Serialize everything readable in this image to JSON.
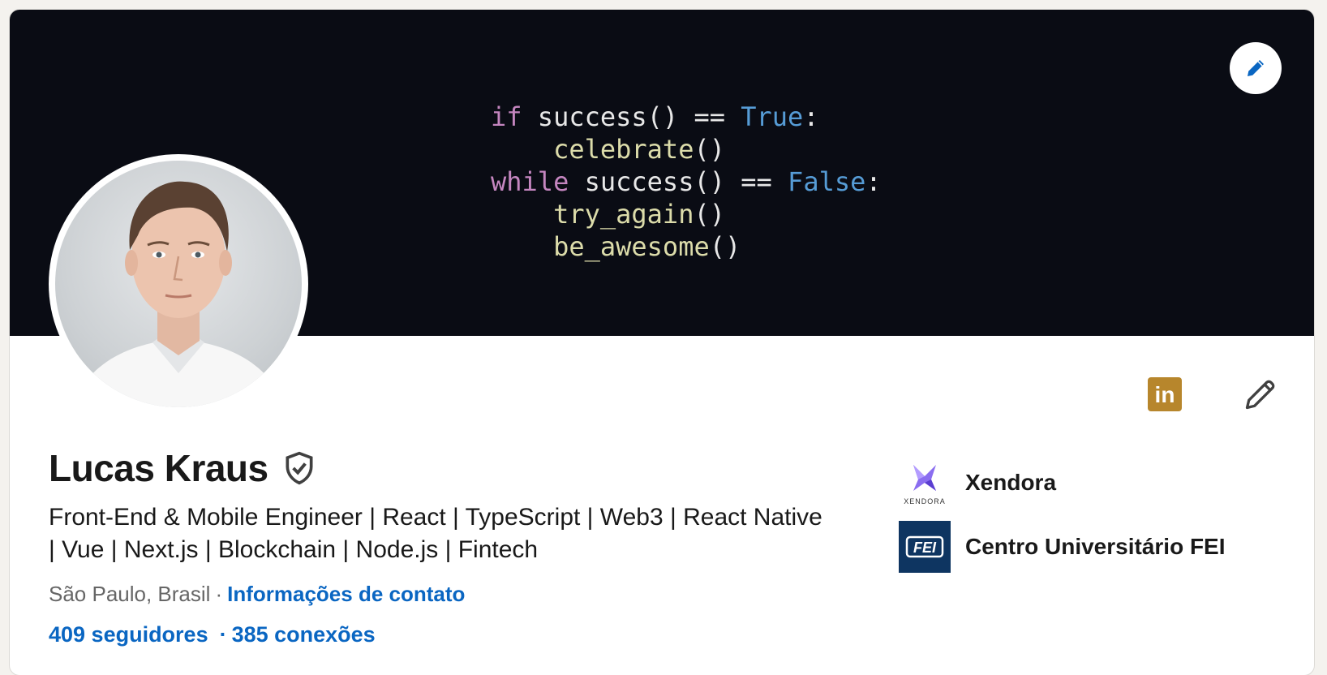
{
  "banner": {
    "code_lines": [
      [
        {
          "t": "if",
          "c": "kw"
        },
        {
          "t": " success() == ",
          "c": "plain"
        },
        {
          "t": "True",
          "c": "bool"
        },
        {
          "t": ":",
          "c": "plain"
        }
      ],
      [
        {
          "t": "    ",
          "c": "plain"
        },
        {
          "t": "celebrate",
          "c": "fn"
        },
        {
          "t": "()",
          "c": "plain"
        }
      ],
      [
        {
          "t": "while",
          "c": "kw"
        },
        {
          "t": " success() == ",
          "c": "plain"
        },
        {
          "t": "False",
          "c": "bool"
        },
        {
          "t": ":",
          "c": "plain"
        }
      ],
      [
        {
          "t": "    ",
          "c": "plain"
        },
        {
          "t": "try_again",
          "c": "fn"
        },
        {
          "t": "()",
          "c": "plain"
        }
      ],
      [
        {
          "t": "    ",
          "c": "plain"
        },
        {
          "t": "be_awesome",
          "c": "fn"
        },
        {
          "t": "()",
          "c": "plain"
        }
      ]
    ],
    "edit_icon": "pencil-icon",
    "background_color": "#0a0c14"
  },
  "profile": {
    "name": "Lucas Kraus",
    "verified_icon": "shield-check-icon",
    "headline": "Front-End & Mobile Engineer | React | TypeScript | Web3 | React Native | Vue | Next.js | Blockchain | Node.js | Fintech",
    "location": "São Paulo, Brasil",
    "location_separator": "·",
    "contact_link": "Informações de contato",
    "followers": "409 seguidores",
    "stats_separator": "·",
    "connections": "385 conexões"
  },
  "actions": {
    "linkedin_icon": "linkedin-icon",
    "linkedin_text": "in",
    "edit_icon": "pencil-icon"
  },
  "organizations": [
    {
      "name": "Xendora",
      "logo_text": "XENDORA",
      "logo_icon": "xendora-logo-icon"
    },
    {
      "name": "Centro Universitário FEI",
      "logo_text": "FEI",
      "logo_icon": "fei-logo-icon"
    }
  ],
  "colors": {
    "link": "#0a66c2",
    "text": "#191919",
    "muted": "#666666",
    "linkedin_gold": "#b7862c",
    "fei_blue": "#0e3561"
  }
}
